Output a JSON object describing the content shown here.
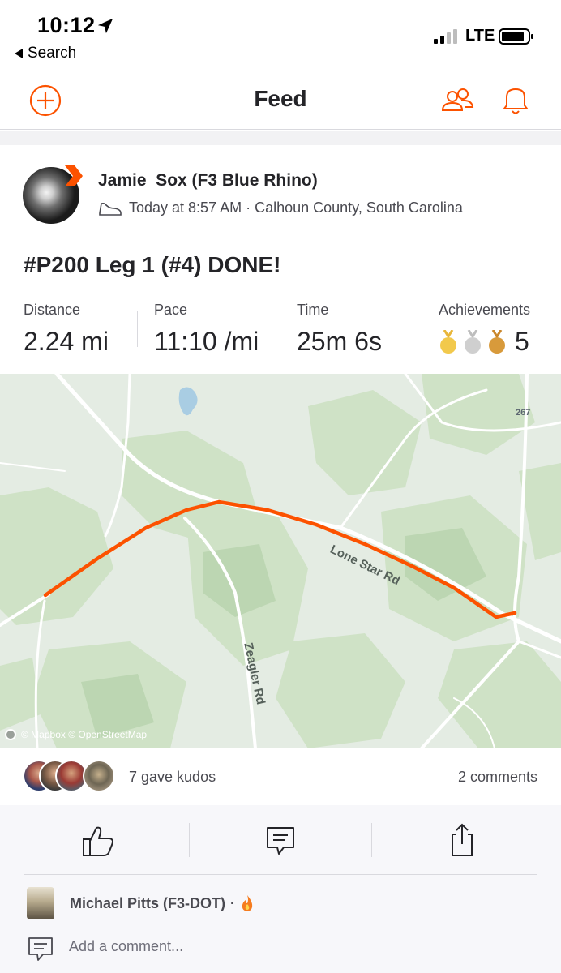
{
  "status_bar": {
    "time": "10:12",
    "back_label": "Search",
    "network": "LTE"
  },
  "header": {
    "title": "Feed",
    "icons": [
      "add-icon",
      "athletes-icon",
      "notifications-icon"
    ],
    "accent_color": "#fc5200"
  },
  "activity": {
    "athlete_name": "Jamie  Sox (F3 Blue Rhino)",
    "meta": "Today at 8:57 AM · Calhoun County, South Carolina",
    "title": "#P200 Leg 1 (#4) DONE!",
    "stats": [
      {
        "label": "Distance",
        "value": "2.24 mi"
      },
      {
        "label": "Pace",
        "value": "11:10 /mi"
      },
      {
        "label": "Time",
        "value": "25m 6s"
      }
    ],
    "achievements": {
      "label": "Achievements",
      "count": "5",
      "medals": [
        "gold",
        "silver",
        "bronze"
      ]
    }
  },
  "map": {
    "attribution": "© Mapbox © OpenStreetMap",
    "road_labels": [
      "Lone Star Rd",
      "Zeagler Rd"
    ],
    "route_shield": "267",
    "route_color": "#fc5200"
  },
  "social": {
    "kudos_text": "7 gave kudos",
    "comments_text": "2 comments",
    "actions": [
      "kudos-button",
      "comment-button",
      "share-button"
    ]
  },
  "comments": {
    "commenter": "Michael Pitts (F3-DOT)",
    "separator": "·",
    "placeholder": "Add a comment..."
  }
}
